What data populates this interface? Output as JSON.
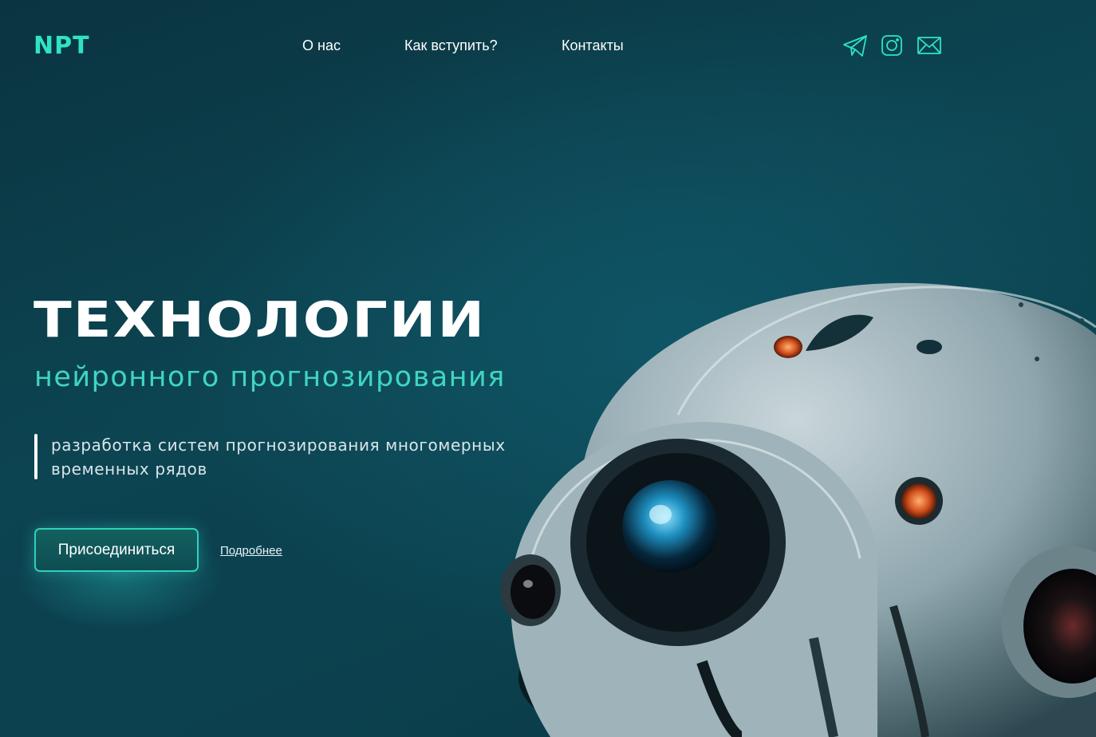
{
  "header": {
    "logo": "NPT",
    "nav": [
      {
        "label": "О нас"
      },
      {
        "label": "Как вступить?"
      },
      {
        "label": "Контакты"
      }
    ],
    "social_icons": [
      "telegram-icon",
      "instagram-icon",
      "mail-icon"
    ]
  },
  "hero": {
    "title": "ТЕХНОЛОГИИ",
    "subtitle": "нейронного прогнозирования",
    "description_line1": "разработка систем прогнозирования многомерных",
    "description_line2": "временных рядов",
    "join_button": "Присоединиться",
    "more_link": "Подробнее"
  },
  "colors": {
    "accent": "#2fe3c4",
    "subtitle": "#3fd6c0",
    "background": "#0d4653",
    "text": "#ffffff"
  }
}
